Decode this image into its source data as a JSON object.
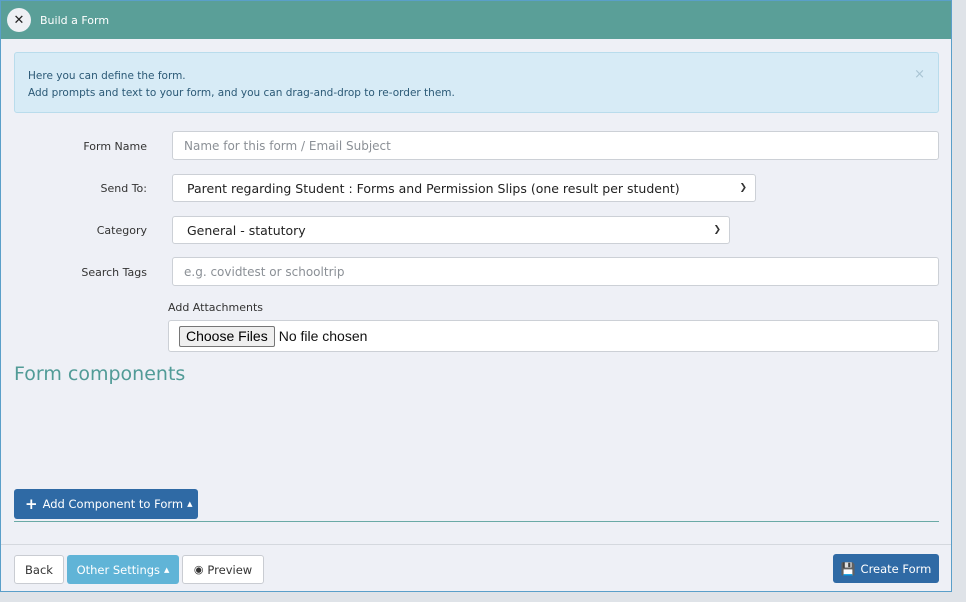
{
  "header": {
    "title": "Build a Form",
    "close_glyph": "✕"
  },
  "alert": {
    "line1": "Here you can define the form.",
    "line2": "Add prompts and text to your form, and you can drag-and-drop to re-order them.",
    "close_glyph": "×"
  },
  "fields": {
    "form_name": {
      "label": "Form Name",
      "value": "",
      "placeholder": "Name for this form / Email Subject"
    },
    "send_to": {
      "label": "Send To:",
      "selected": "Parent regarding Student : Forms and Permission Slips (one result per student)"
    },
    "category": {
      "label": "Category",
      "selected": "General - statutory"
    },
    "search_tags": {
      "label": "Search Tags",
      "value": "",
      "placeholder": "e.g. covidtest or schooltrip"
    }
  },
  "attachments": {
    "label": "Add Attachments",
    "choose_label": "Choose Files",
    "status": "No file chosen"
  },
  "components": {
    "title": "Form components",
    "add_button_label": "Add Component to Form"
  },
  "footer": {
    "back_label": "Back",
    "other_settings_label": "Other Settings",
    "preview_label": "Preview",
    "create_label": "Create Form"
  },
  "icons": {
    "close": "close-icon",
    "plus": "plus-icon",
    "caret_up": "caret-up-icon",
    "chevron_down": "chevron-down-icon",
    "eye": "eye-icon",
    "save": "save-icon"
  },
  "colors": {
    "header": "#5a9f98",
    "accent_teal": "#519b97",
    "primary": "#2f6aa5",
    "info_button": "#60b4d7",
    "alert_bg": "#d7ebf6"
  }
}
